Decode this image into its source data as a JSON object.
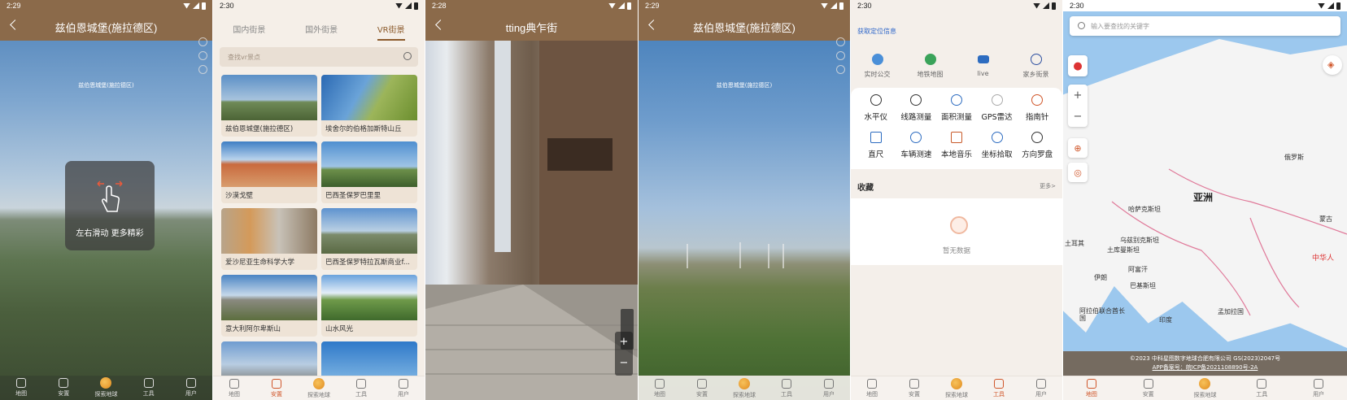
{
  "panels": {
    "p1": {
      "time": "2:29",
      "title": "兹伯恩城堡(施拉德区)",
      "caption": "兹伯恩城堡(施拉德区)",
      "swipe_hint": "左右滑动 更多精彩",
      "nav": [
        "地图",
        "安置",
        "探索地球",
        "工具",
        "用户"
      ]
    },
    "p2": {
      "time": "2:30",
      "tabs": [
        "国内街景",
        "国外街景",
        "VR街景"
      ],
      "search_placeholder": "查找vr景点",
      "cards": [
        "兹伯恩城堡(施拉德区)",
        "埃舍尔的伯格加斯特山丘",
        "沙漠戈壁",
        "巴西圣保罗巴里里",
        "爱沙尼亚生命科学大学",
        "巴西圣保罗特拉瓦斯商业f...",
        "意大利阿尔卑斯山",
        "山水风光",
        "",
        ""
      ],
      "nav": [
        "地图",
        "安置",
        "探索地球",
        "工具",
        "用户"
      ]
    },
    "p3": {
      "time": "2:28",
      "title": "tting典乍街"
    },
    "p4": {
      "time": "2:29",
      "title": "兹伯恩城堡(施拉德区)",
      "caption": "兹伯恩城堡(施拉德区)",
      "nav": [
        "地图",
        "安置",
        "探索地球",
        "工具",
        "用户"
      ]
    },
    "p5": {
      "time": "2:30",
      "location_link": "获取定位信息",
      "row1": [
        "实时公交",
        "地铁地图",
        "live",
        "家乡街景"
      ],
      "tools": [
        "水平仪",
        "线路测量",
        "面积测量",
        "GPS雷达",
        "指南针",
        "直尺",
        "车辆测速",
        "本地音乐",
        "坐标拾取",
        "方向罗盘"
      ],
      "favorites_title": "收藏",
      "more": "更多>",
      "empty": "暂无数据",
      "nav": [
        "地图",
        "安置",
        "探索地球",
        "工具",
        "用户"
      ]
    },
    "p6": {
      "time": "2:30",
      "search_placeholder": "输入要查找的关键字",
      "labels": {
        "asia": "亚洲",
        "russia": "俄罗斯",
        "kazakhstan": "哈萨克斯坦",
        "uzbek": "乌兹别克斯坦",
        "turkmen": "土库曼斯坦",
        "afghan": "阿富汗",
        "pakistan": "巴基斯坦",
        "iran": "伊朗",
        "uae": "阿拉伯联合酋长国",
        "india": "印度",
        "bangla": "孟加拉国",
        "china": "中华人",
        "mongolia": "蒙古",
        "turkey": "土耳其"
      },
      "copyright": "©2023 中科星图数字地球合肥有限公司 GS(2023)2047号",
      "icp": "APP备案号：皖ICP备2021108890号-2A",
      "nav": [
        "地图",
        "安置",
        "探索地球",
        "工具",
        "用户"
      ]
    }
  }
}
